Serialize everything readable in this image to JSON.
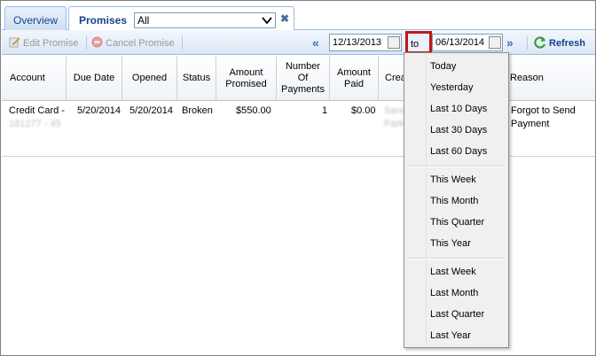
{
  "tabs": {
    "overview_label": "Overview",
    "promises_label": "Promises",
    "filter_value": "All",
    "close_glyph": "✖"
  },
  "toolbar": {
    "edit_label": "Edit Promise",
    "cancel_label": "Cancel Promise",
    "prev_glyph": "«",
    "next_glyph": "»",
    "date_from": "12/13/2013",
    "to_label": "to",
    "date_to": "06/13/2014",
    "refresh_label": "Refresh"
  },
  "grid": {
    "headers": {
      "account": "Account",
      "due_date": "Due Date",
      "opened": "Opened",
      "status": "Status",
      "amount_promised_1": "Amount",
      "amount_promised_2": "Promised",
      "num_payments_1": "Number",
      "num_payments_2": "Of",
      "num_payments_3": "Payments",
      "amount_paid_1": "Amount",
      "amount_paid_2": "Paid",
      "created": "Crea",
      "reason": "Reason"
    },
    "row": {
      "account_1": "Credit Card -",
      "account_2": "181277 - 45",
      "due_date": "5/20/2014",
      "opened": "5/20/2014",
      "status": "Broken",
      "amount_promised": "$550.00",
      "num_payments": "1",
      "amount_paid": "$0.00",
      "created_1": "Sand",
      "created_2": "Parks",
      "reason_1": "Forgot to Send",
      "reason_2": "Payment"
    }
  },
  "dropdown": {
    "group1": [
      "Today",
      "Yesterday",
      "Last 10 Days",
      "Last 30 Days",
      "Last 60 Days"
    ],
    "group2": [
      "This Week",
      "This Month",
      "This Quarter",
      "This Year"
    ],
    "group3": [
      "Last Week",
      "Last Month",
      "Last Quarter",
      "Last Year"
    ]
  },
  "colors": {
    "accent": "#15428b",
    "highlight_border": "#c0161c",
    "header_border": "#99bbe8"
  }
}
